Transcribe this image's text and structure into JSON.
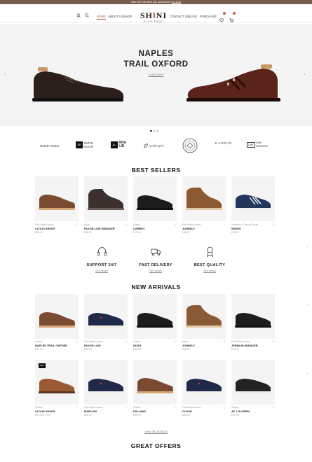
{
  "topbar": {
    "text": "Take 30% off when you spend $120",
    "link": "Go shop"
  },
  "header": {
    "nav_left": [
      "HOME",
      "ABOUT US",
      "SHOP"
    ],
    "nav_right": [
      "CONTACT US",
      "BLOG",
      "PURCHASE"
    ],
    "logo": {
      "text": "SHONI",
      "tagline": "BLUE SHOP"
    },
    "wishlist_count": "0",
    "cart_count": "0"
  },
  "hero": {
    "title_line1": "NAPLES",
    "title_line2": "TRAIL OXFORD",
    "link": "Look more"
  },
  "brands": [
    "NOLE NOLE",
    "SMITH KILIAN",
    "ANA LIN",
    "goldengrid",
    "BRAND SEAL",
    "KARDIO",
    "LINE FASHION"
  ],
  "best_sellers": {
    "title": "BEST SELLERS",
    "items": [
      {
        "category": "Polo Ralph Lauren",
        "name": "CLOUD SHOES",
        "price": "$ 89.00"
      },
      {
        "category": "Apollo",
        "name": "FAXON LOW SNEAKER",
        "price": "$ 96.00"
      },
      {
        "category": "Classic",
        "name": "CARBEY",
        "price": "$ 79.00"
      },
      {
        "category": "Polo Ralph Lauren",
        "name": "JOHNSLY",
        "price": "$ 88.00"
      },
      {
        "category": "Sneakers & Canvas Shoes",
        "name": "SHOES",
        "price": "$ 98.00"
      }
    ]
  },
  "services": [
    {
      "title": "SUPPORT 24/7",
      "link": "See details",
      "icon": "headset-icon"
    },
    {
      "title": "FAST DELIVERY",
      "link": "See details",
      "icon": "truck-icon"
    },
    {
      "title": "BEST QUALITY",
      "link": "See details",
      "icon": "award-icon"
    }
  ],
  "new_arrivals": {
    "title": "NEW ARRIVALS",
    "row1": [
      {
        "category": "Classic",
        "name": "NAPLES TRAIL OXFORD",
        "price": "$ 99.00"
      },
      {
        "category": "Polo Ralph Lauren",
        "name": "FAXON LOW",
        "price": "$ 92.00"
      },
      {
        "category": "Classic",
        "name": "HUSH",
        "price": "$ 89.00"
      },
      {
        "category": "Apollo",
        "name": "JOHNSLY",
        "price": "$ 88.00"
      },
      {
        "category": "Polo Ralph Lauren",
        "name": "JERMAIN SNEAKER",
        "price": "$ 99.00"
      }
    ],
    "row2": [
      {
        "category": "Classic",
        "name": "CLOUD SHOES",
        "price": "$ 99.00   $ 79.00",
        "badge": "NEW"
      },
      {
        "category": "Polo Ralph Lauren",
        "name": "MARLOW",
        "price": "$ 95.00"
      },
      {
        "category": "Classic",
        "name": "DILLIANS",
        "price": "$ 89.00"
      },
      {
        "category": "Polo Ralph Lauren",
        "name": "CLOUD",
        "price": "$ 89.00"
      },
      {
        "category": "Classic",
        "name": "AF 1 IN PREM",
        "price": "$ 99.00"
      }
    ],
    "view_all": "View all products"
  },
  "great_offers": {
    "title": "GREAT OFFERS"
  },
  "colors": {
    "accent": "#b3532e",
    "topbar": "#7a5c4c",
    "card_bg": "#f4f4f4"
  }
}
